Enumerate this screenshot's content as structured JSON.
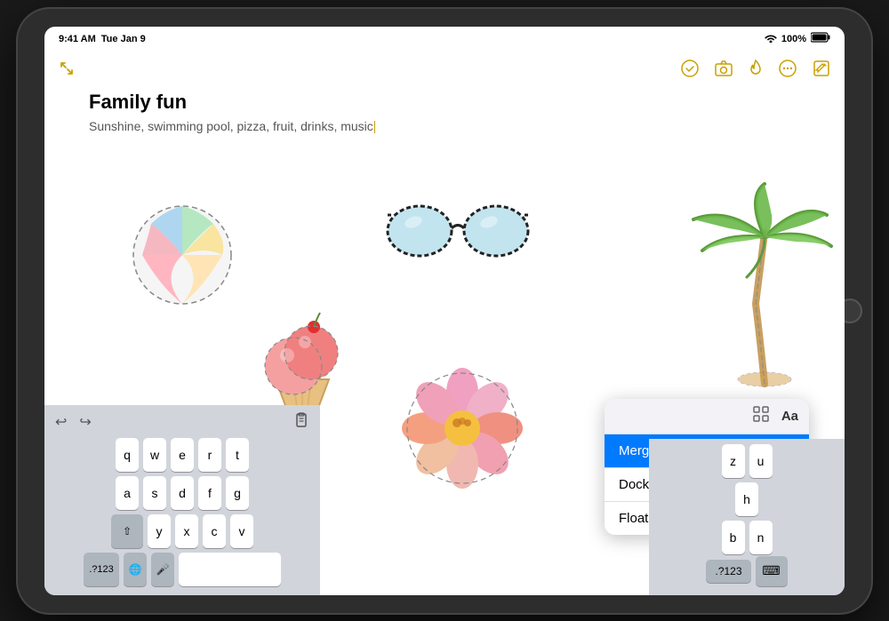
{
  "status_bar": {
    "time": "9:41 AM",
    "day": "Tue Jan 9",
    "wifi_icon": "wifi",
    "battery": "100%",
    "battery_icon": "battery-full"
  },
  "toolbar": {
    "collapse_icon": "arrow-collapse",
    "check_icon": "checkmark-circle",
    "camera_icon": "camera",
    "fire_icon": "flame",
    "more_icon": "ellipsis-circle",
    "edit_icon": "pencil-square"
  },
  "note": {
    "title": "Family fun",
    "subtitle": "Sunshine, swimming pool, pizza, fruit, drinks, music"
  },
  "context_menu": {
    "header": {
      "grid_icon": "grid",
      "text_icon": "Aa"
    },
    "items": [
      {
        "label": "Merge",
        "state": "active"
      },
      {
        "label": "Dock and Merge",
        "state": "normal"
      },
      {
        "label": "Floating",
        "state": "normal"
      }
    ]
  },
  "keyboard": {
    "rows": [
      [
        "q",
        "w",
        "e",
        "r",
        "t"
      ],
      [
        "a",
        "s",
        "d",
        "f",
        "g"
      ],
      [
        "⇧",
        "y",
        "x",
        "c",
        "v"
      ]
    ],
    "bottom": [
      ".?123",
      "🌐",
      "🎤"
    ],
    "space_label": "",
    "right_rows": [
      [
        "z",
        "u"
      ],
      [
        "h"
      ],
      [
        "b",
        "n"
      ]
    ],
    "bottom_right": [
      ".?123",
      "⌨"
    ]
  },
  "stickers": {
    "beach_ball": "beach ball drawing",
    "sunglasses": "sunglasses drawing",
    "palm_tree": "palm tree drawing",
    "ice_cream": "ice cream drawing",
    "flower": "flower drawing"
  }
}
